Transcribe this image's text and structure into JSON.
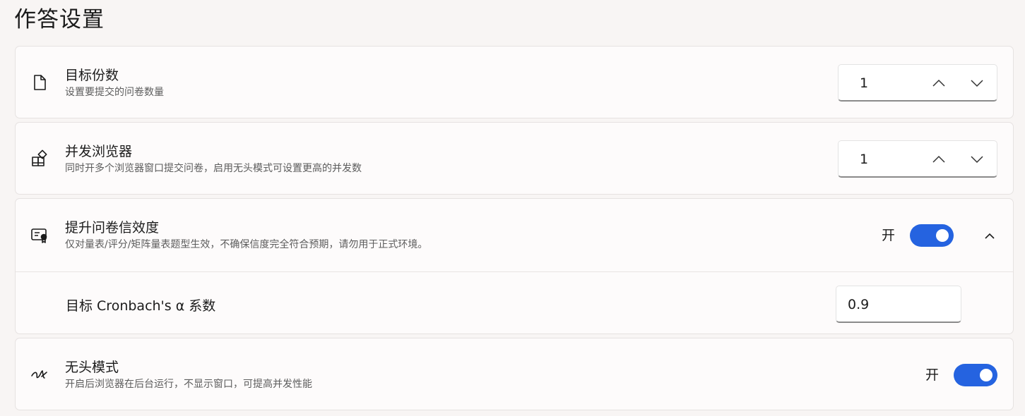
{
  "page_title": "作答设置",
  "settings": {
    "target_count": {
      "icon": "document-icon",
      "title": "目标份数",
      "description": "设置要提交的问卷数量",
      "value": "1"
    },
    "concurrent_browsers": {
      "icon": "apps-add-icon",
      "title": "并发浏览器",
      "description": "同时开多个浏览器窗口提交问卷，启用无头模式可设置更高的并发数",
      "value": "1"
    },
    "reliability": {
      "icon": "certificate-icon",
      "title": "提升问卷信效度",
      "description": "仅对量表/评分/矩阵量表题型生效，不确保信度完全符合预期，请勿用于正式环境。",
      "toggle_label": "开",
      "toggle_on": true,
      "expanded": true,
      "sub_setting": {
        "label": "目标 Cronbach's α 系数",
        "value": "0.9"
      }
    },
    "headless": {
      "icon": "signature-icon",
      "title": "无头模式",
      "description": "开启后浏览器在后台运行，不显示窗口，可提高并发性能",
      "toggle_label": "开",
      "toggle_on": true
    }
  },
  "colors": {
    "accent": "#2563e0",
    "background": "#f8f5f4",
    "card": "#fdfbfb",
    "border": "#e6e2e1"
  }
}
